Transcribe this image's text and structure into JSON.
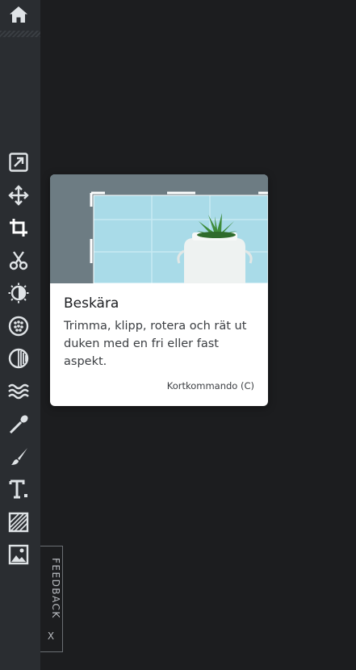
{
  "colors": {
    "sidebar": "#2a2d31",
    "canvas": "#1c1d1f",
    "icon": "#dfe3e6",
    "tooltip_bg": "#ffffff"
  },
  "toolbar": {
    "home_icon": "home-icon",
    "tools": [
      {
        "id": "resize",
        "icon": "resize-icon"
      },
      {
        "id": "move",
        "icon": "move-arrows-icon"
      },
      {
        "id": "crop",
        "icon": "crop-icon",
        "active": true
      },
      {
        "id": "cut",
        "icon": "scissors-icon"
      },
      {
        "id": "adjust",
        "icon": "exposure-icon"
      },
      {
        "id": "filter",
        "icon": "filter-dots-icon"
      },
      {
        "id": "vignette",
        "icon": "vignette-icon"
      },
      {
        "id": "waves",
        "icon": "waves-icon"
      },
      {
        "id": "touchup",
        "icon": "wand-icon"
      },
      {
        "id": "draw",
        "icon": "brush-icon"
      },
      {
        "id": "text",
        "icon": "text-icon"
      },
      {
        "id": "texture",
        "icon": "texture-icon"
      },
      {
        "id": "image",
        "icon": "image-icon"
      }
    ]
  },
  "tooltip": {
    "title": "Beskära",
    "description": "Trimma, klipp, rotera och rät ut duken med en fri eller fast aspekt.",
    "shortcut": "Kortkommando (C)"
  },
  "feedback": {
    "label": "FEEDBACK",
    "close": "X"
  }
}
